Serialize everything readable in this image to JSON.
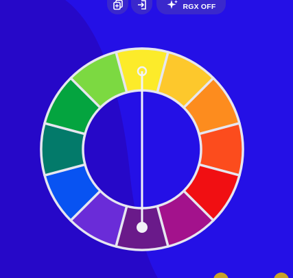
{
  "toolbar": {
    "copy_icon": "copy-icon",
    "export_icon": "export-icon",
    "rgx_icon": "sparkle-icon",
    "rgx_label": "RGX OFF"
  },
  "wheel": {
    "type": "color-wheel",
    "segment_count": 12,
    "segment_colors": [
      "#FCEB2A",
      "#FDC82C",
      "#FD8C1E",
      "#FC4C1D",
      "#F10F12",
      "#A3128C",
      "#6A1A8A",
      "#6A2CD8",
      "#0853F2",
      "#037A6A",
      "#04A43F",
      "#7CD941"
    ],
    "selected_index": 0,
    "knob_end_index": 6,
    "colors": {
      "background": "#2410E6",
      "background_shadow": "#2608C8",
      "ring_border": "#E6E6F0",
      "button_bg": "#3A28CC"
    }
  }
}
